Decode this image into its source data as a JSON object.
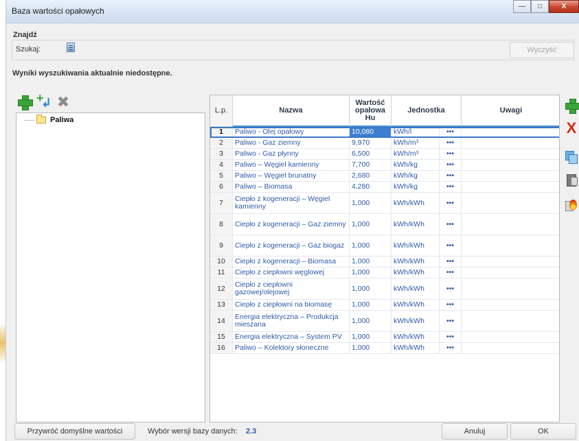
{
  "window": {
    "title": "Baza wartości opałowych",
    "minimize_icon": "minimize-icon",
    "maximize_icon": "maximize-icon",
    "close_label": "X"
  },
  "search": {
    "group_label": "Znajdź",
    "label": "Szukaj:",
    "input_icon": "document-lines-icon",
    "clear_label": "Wyczyść",
    "results_message": "Wyniki wyszukiwania aktualnie niedostępne."
  },
  "tree": {
    "toolbar_icons": [
      "add-icon",
      "add-subitem-icon",
      "delete-icon"
    ],
    "root_label": "Paliwa"
  },
  "grid": {
    "headers": {
      "lp": "L.p.",
      "name": "Nazwa",
      "value": "Wartość opałowa Hu",
      "unit": "Jednostka",
      "notes": "Uwagi"
    },
    "rows": [
      {
        "lp": "1",
        "name": "Paliwo - Olej opałowy",
        "value": "10,080",
        "unit": "kWh/l",
        "dots": "•••",
        "notes": ""
      },
      {
        "lp": "2",
        "name": "Paliwo - Gaz ziemny",
        "value": "9,970",
        "unit": "kWh/m³",
        "dots": "•••",
        "notes": ""
      },
      {
        "lp": "3",
        "name": "Paliwo - Gaz płynny",
        "value": "6,500",
        "unit": "kWh/m³",
        "dots": "•••",
        "notes": ""
      },
      {
        "lp": "4",
        "name": "Paliwo – Węgiel kamienny",
        "value": "7,700",
        "unit": "kWh/kg",
        "dots": "•••",
        "notes": ""
      },
      {
        "lp": "5",
        "name": "Paliwo – Węgiel brunatny",
        "value": "2,680",
        "unit": "kWh/kg",
        "dots": "•••",
        "notes": ""
      },
      {
        "lp": "6",
        "name": "Paliwo – Biomasa",
        "value": "4,280",
        "unit": "kWh/kg",
        "dots": "•••",
        "notes": ""
      },
      {
        "lp": "7",
        "name": "Ciepło z kogeneracji – Węgiel kamienny",
        "value": "1,000",
        "unit": "kWh/kWh",
        "dots": "•••",
        "notes": ""
      },
      {
        "lp": "8",
        "name": "Ciepło z kogeneracji – Gaz ziemny",
        "value": "1,000",
        "unit": "kWh/kWh",
        "dots": "•••",
        "notes": ""
      },
      {
        "lp": "9",
        "name": "Ciepło z kogeneracji – Gaz biogaz",
        "value": "1,000",
        "unit": "kWh/kWh",
        "dots": "•••",
        "notes": ""
      },
      {
        "lp": "10",
        "name": "Ciepło z kogeneracji – Biomasa",
        "value": "1,000",
        "unit": "kWh/kWh",
        "dots": "•••",
        "notes": ""
      },
      {
        "lp": "11",
        "name": "Ciepło z ciepłowni węglowej",
        "value": "1,000",
        "unit": "kWh/kWh",
        "dots": "•••",
        "notes": ""
      },
      {
        "lp": "12",
        "name": "Ciepło z ciepłowni gazowej/olejowej",
        "value": "1,000",
        "unit": "kWh/kWh",
        "dots": "•••",
        "notes": ""
      },
      {
        "lp": "13",
        "name": "Ciepło z ciepłowni na biomasę",
        "value": "1,000",
        "unit": "kWh/kWh",
        "dots": "•••",
        "notes": ""
      },
      {
        "lp": "14",
        "name": "Energia elektryczna – Produkcja mieszana",
        "value": "1,000",
        "unit": "kWh/kWh",
        "dots": "•••",
        "notes": ""
      },
      {
        "lp": "15",
        "name": "Energia elektryczna – System PV",
        "value": "1,000",
        "unit": "kWh/kWh",
        "dots": "•••",
        "notes": ""
      },
      {
        "lp": "16",
        "name": "Paliwo – Kolektory słoneczne",
        "value": "1,000",
        "unit": "kWh/kWh",
        "dots": "•••",
        "notes": ""
      }
    ],
    "selected_row": 1
  },
  "side_toolbar": {
    "icons": [
      "add-icon",
      "delete-icon",
      "copy-icon",
      "paste-icon",
      "fuel-import-icon"
    ],
    "delete_glyph": "X"
  },
  "footer": {
    "restore_label": "Przywróć domyślne wartości",
    "version_label": "Wybór wersji bazy danych:",
    "version_value": "2.3",
    "cancel_label": "Anuluj",
    "ok_label": "OK"
  },
  "colors": {
    "link_blue": "#2f5aa8",
    "selection_blue": "#3d7fd0",
    "add_green": "#3aa53a",
    "delete_red": "#d72a16"
  }
}
